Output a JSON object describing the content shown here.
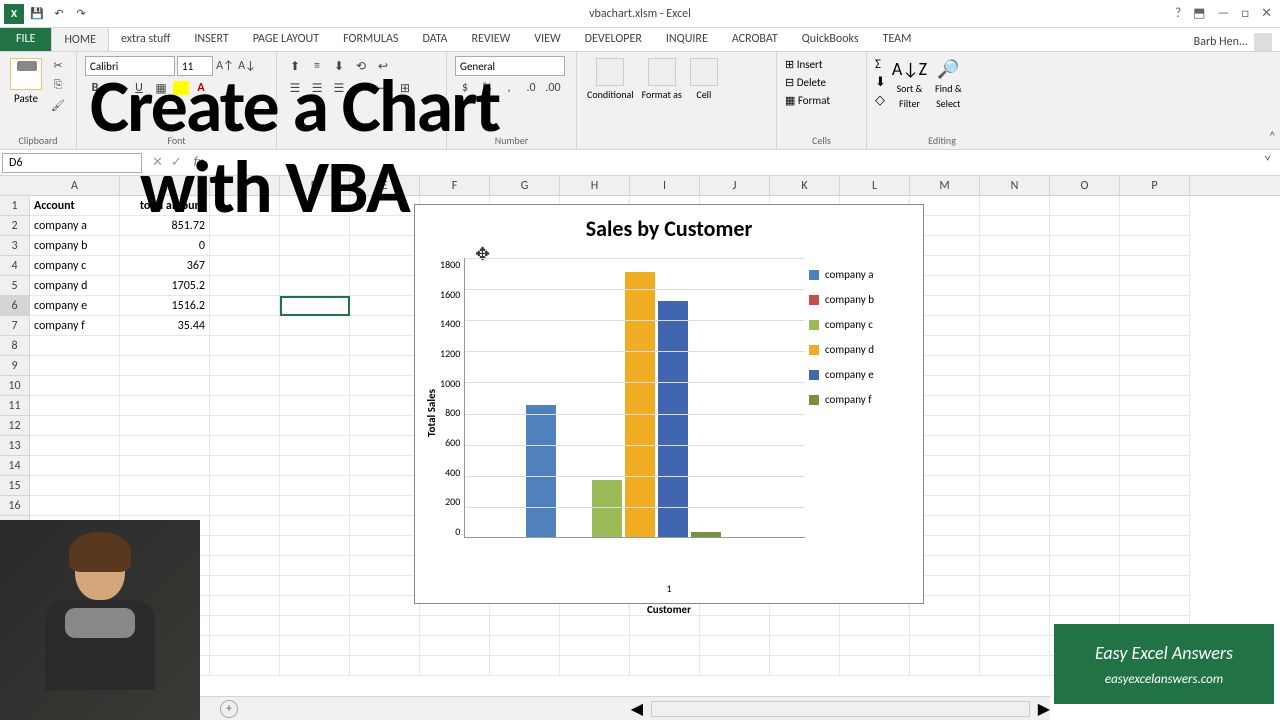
{
  "window": {
    "title": "vbachart.xlsm - Excel",
    "help_icon": "?"
  },
  "qat": {
    "save": "💾",
    "undo": "↶",
    "redo": "↷"
  },
  "tabs": {
    "file": "FILE",
    "items": [
      "HOME",
      "extra stuff",
      "INSERT",
      "PAGE LAYOUT",
      "FORMULAS",
      "DATA",
      "REVIEW",
      "VIEW",
      "DEVELOPER",
      "INQUIRE",
      "ACROBAT",
      "QuickBooks",
      "TEAM"
    ],
    "active": 0,
    "user": "Barb Hen..."
  },
  "ribbon": {
    "clipboard": {
      "paste": "Paste",
      "label": "Clipboard"
    },
    "font": {
      "name": "Calibri",
      "size": "11",
      "label": "Font"
    },
    "number": {
      "format": "General",
      "label": "Number"
    },
    "styles": {
      "cond": "Conditional",
      "fmt_as": "Format as",
      "cell": "Cell"
    },
    "cells": {
      "insert": "Insert",
      "delete": "Delete",
      "format": "Format",
      "label": "Cells"
    },
    "editing": {
      "sort": "Sort &",
      "filter": "Filter",
      "find": "Find &",
      "select": "Select",
      "label": "Editing"
    }
  },
  "formula_bar": {
    "name_box": "D6",
    "fx": "fx"
  },
  "overlay": {
    "line1": "Create a Chart",
    "line2": "with VBA"
  },
  "columns": [
    "A",
    "B",
    "C",
    "D",
    "E",
    "F",
    "G",
    "H",
    "I",
    "J",
    "K",
    "L",
    "M",
    "N",
    "O",
    "P"
  ],
  "table": {
    "headers": {
      "a": "Account",
      "b": "total amount"
    },
    "rows": [
      {
        "r": "2",
        "a": "company a",
        "b": "851.72"
      },
      {
        "r": "3",
        "a": "company b",
        "b": "0"
      },
      {
        "r": "4",
        "a": "company c",
        "b": "367"
      },
      {
        "r": "5",
        "a": "company d",
        "b": "1705.2"
      },
      {
        "r": "6",
        "a": "company e",
        "b": "1516.2"
      },
      {
        "r": "7",
        "a": "company f",
        "b": "35.44"
      }
    ]
  },
  "chart_data": {
    "type": "bar",
    "title": "Sales by Customer",
    "xlabel": "Customer",
    "ylabel": "Total Sales",
    "x_tick": "1",
    "ylim": [
      0,
      1800
    ],
    "y_ticks": [
      "1800",
      "1600",
      "1400",
      "1200",
      "1000",
      "800",
      "600",
      "400",
      "200",
      "0"
    ],
    "series": [
      {
        "name": "company a",
        "value": 851.72,
        "color": "#4f81bd"
      },
      {
        "name": "company b",
        "value": 0,
        "color": "#c0504d"
      },
      {
        "name": "company c",
        "value": 367,
        "color": "#9bbb59"
      },
      {
        "name": "company d",
        "value": 1705.2,
        "color": "#f0ad24"
      },
      {
        "name": "company e",
        "value": 1516.2,
        "color": "#4166b0"
      },
      {
        "name": "company f",
        "value": 35.44,
        "color": "#77933c"
      }
    ]
  },
  "watermark": {
    "title": "Easy Excel Answers",
    "url": "easyexcelanswers.com"
  },
  "selected_cell": {
    "row": 6,
    "col": "D"
  }
}
